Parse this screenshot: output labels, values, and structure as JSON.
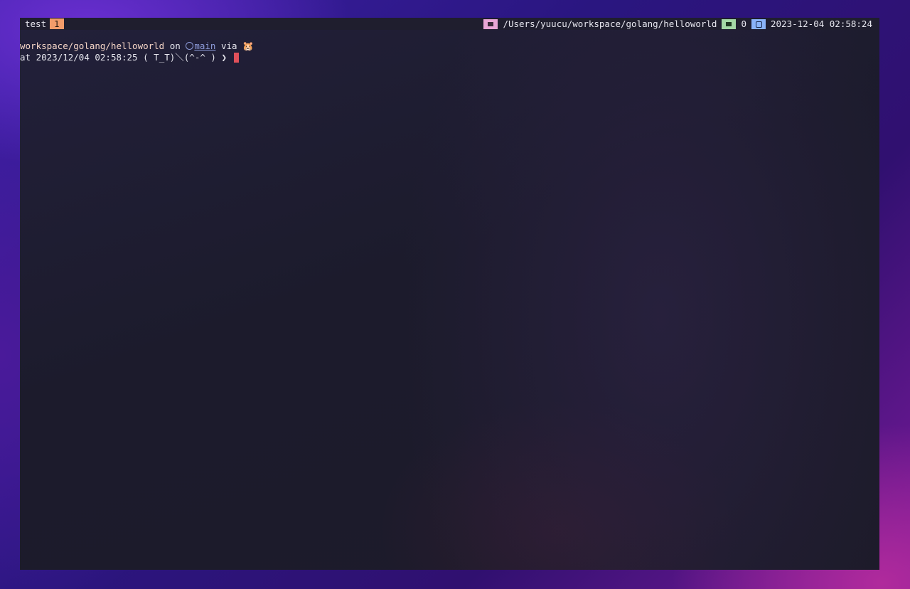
{
  "statusbar": {
    "session": "test",
    "window_index": "1",
    "path": "/Users/yuucu/workspace/golang/helloworld",
    "pane_count": "0",
    "datetime": "2023-12-04 02:58:24"
  },
  "prompt": {
    "dir": "workspace/golang/helloworld",
    "on_word": "on",
    "branch": "main",
    "via_word": "via",
    "tool_icon": "🐹",
    "time_prefix": "at",
    "time": "2023/12/04 02:58:25",
    "face": "( T_T)＼(^-^ )",
    "prompt_char": "❯"
  },
  "icons": {
    "folder": "folder-icon",
    "terminal": "terminal-icon",
    "clock": "clock-icon",
    "branch": "github-icon",
    "tool": "gopher-icon"
  },
  "colors": {
    "window_badge": "#f39c6a",
    "folder_badge": "#e9a6d6",
    "terminal_badge": "#a3d9a5",
    "clock_badge": "#8ab4f8",
    "cursor": "#e0505a"
  }
}
